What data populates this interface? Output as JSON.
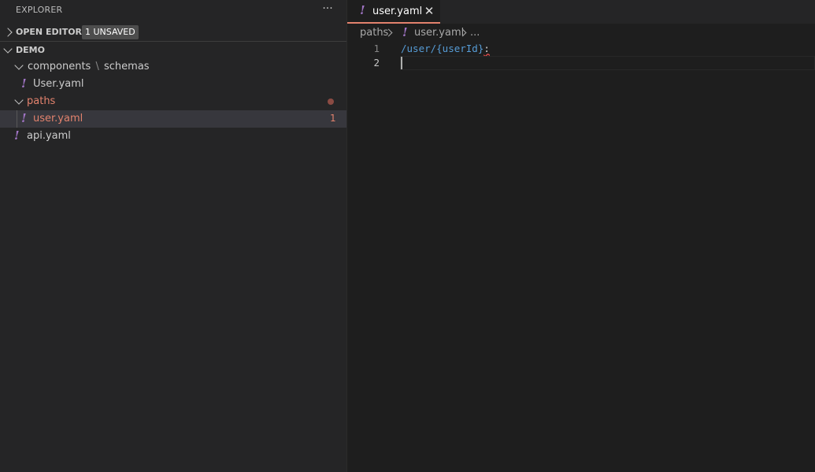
{
  "sidebar": {
    "title": "EXPLORER",
    "more_actions": "···",
    "open_editors": {
      "label": "OPEN EDITORS",
      "badge": "1 UNSAVED"
    },
    "workspace": {
      "label": "DEMO"
    },
    "tree": {
      "components_folder": "components",
      "components_sep": "\\",
      "schemas_folder": "schemas",
      "schema_file": "User.yaml",
      "paths_folder": "paths",
      "path_file": "user.yaml",
      "path_file_problems": "1",
      "api_file": "api.yaml"
    }
  },
  "tab": {
    "label": "user.yaml",
    "close": "✕"
  },
  "breadcrumb": {
    "folder": "paths",
    "file": "user.yaml",
    "more": "..."
  },
  "editor": {
    "lines": [
      {
        "number": "1",
        "text": "/user/{userId}",
        "suffix": ":"
      },
      {
        "number": "2",
        "text": ""
      }
    ]
  },
  "icons": {
    "yaml_glyph": "!"
  },
  "colors": {
    "sidebar_bg": "#252526",
    "editor_bg": "#1e1e1e",
    "modified": "#e2826d",
    "yaml_icon": "#a074c4",
    "key": "#569cd6"
  }
}
